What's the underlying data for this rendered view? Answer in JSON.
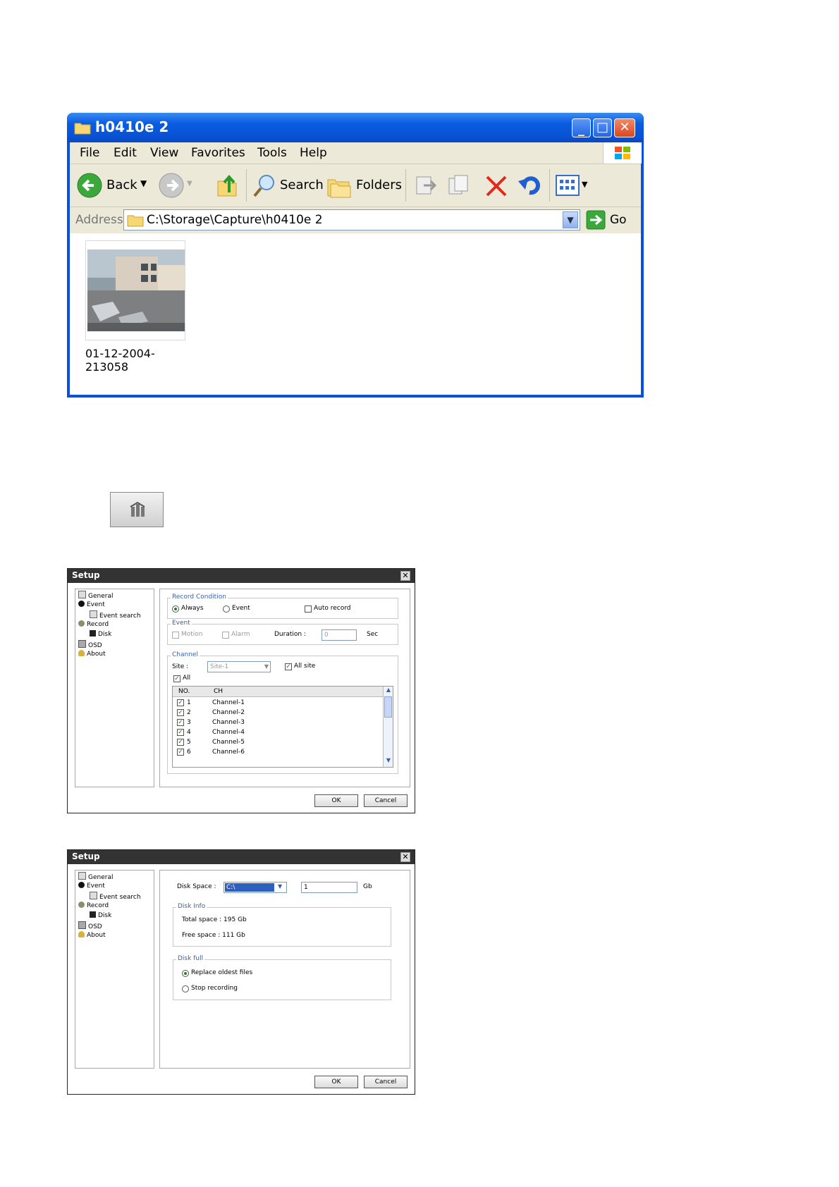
{
  "explorer": {
    "title": "h0410e 2",
    "menu": [
      "File",
      "Edit",
      "View",
      "Favorites",
      "Tools",
      "Help"
    ],
    "toolbar": {
      "back": "Back",
      "search": "Search",
      "folders": "Folders"
    },
    "address": {
      "label": "Address",
      "value": "C:\\Storage\\Capture\\h0410e 2",
      "go": "Go"
    },
    "file": {
      "name": "01-12-2004-213058"
    }
  },
  "setup_icon": "setup-tools-icon",
  "dialog_record": {
    "title": "Setup",
    "tree": [
      "General",
      "Event",
      "Event search",
      "Record",
      "Disk",
      "OSD",
      "About"
    ],
    "record_condition": {
      "label": "Record Condition",
      "always": "Always",
      "event": "Event",
      "auto_record": "Auto record"
    },
    "event": {
      "label": "Event",
      "motion": "Motion",
      "alarm": "Alarm",
      "duration_label": "Duration :",
      "duration_value": "0",
      "unit": "Sec"
    },
    "channel": {
      "label": "Channel",
      "site_label": "Site :",
      "site_value": "Site-1",
      "all_site": "All site",
      "all": "All",
      "col_no": "NO.",
      "col_ch": "CH",
      "rows": [
        {
          "no": "1",
          "ch": "Channel-1"
        },
        {
          "no": "2",
          "ch": "Channel-2"
        },
        {
          "no": "3",
          "ch": "Channel-3"
        },
        {
          "no": "4",
          "ch": "Channel-4"
        },
        {
          "no": "5",
          "ch": "Channel-5"
        },
        {
          "no": "6",
          "ch": "Channel-6"
        }
      ]
    },
    "ok": "OK",
    "cancel": "Cancel"
  },
  "dialog_disk": {
    "title": "Setup",
    "tree": [
      "General",
      "Event",
      "Event search",
      "Record",
      "Disk",
      "OSD",
      "About"
    ],
    "disk_space_label": "Disk Space :",
    "drive": "C:\\",
    "amount": "1",
    "unit": "Gb",
    "disk_info": {
      "label": "Disk Info",
      "total": "Total space : 195 Gb",
      "free": "Free space : 111 Gb"
    },
    "disk_full": {
      "label": "Disk full",
      "replace": "Replace oldest files",
      "stop": "Stop recording"
    },
    "ok": "OK",
    "cancel": "Cancel"
  }
}
